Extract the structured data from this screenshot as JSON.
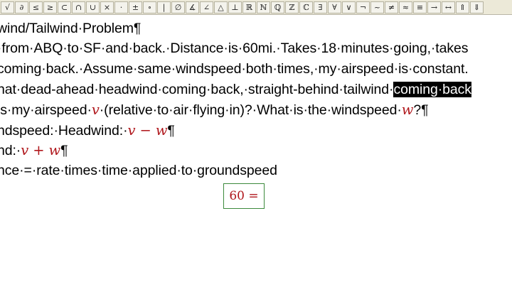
{
  "toolbar": {
    "buttons": [
      {
        "glyph": "√",
        "icon": "radical-icon"
      },
      {
        "glyph": "∂",
        "icon": "partial-icon"
      },
      {
        "glyph": "≤",
        "icon": "less-equal-icon"
      },
      {
        "glyph": "≥",
        "icon": "greater-equal-icon"
      },
      {
        "glyph": "⊂",
        "icon": "subset-icon"
      },
      {
        "glyph": "∩",
        "icon": "intersection-icon"
      },
      {
        "glyph": "∪",
        "icon": "union-icon"
      },
      {
        "glyph": "×",
        "icon": "times-icon"
      },
      {
        "glyph": "·",
        "icon": "dot-icon"
      },
      {
        "glyph": "±",
        "icon": "plus-minus-icon"
      },
      {
        "glyph": "∘",
        "icon": "composition-icon"
      },
      {
        "glyph": "|",
        "icon": "bar-icon"
      },
      {
        "glyph": "∅",
        "icon": "empty-set-icon"
      },
      {
        "glyph": "∡",
        "icon": "measured-angle-icon"
      },
      {
        "glyph": "∠",
        "icon": "angle-icon"
      },
      {
        "glyph": "△",
        "icon": "triangle-icon"
      },
      {
        "glyph": "⊥",
        "icon": "perpendicular-icon"
      },
      {
        "glyph": "ℝ",
        "icon": "reals-icon"
      },
      {
        "glyph": "ℕ",
        "icon": "naturals-icon"
      },
      {
        "glyph": "ℚ",
        "icon": "rationals-icon"
      },
      {
        "glyph": "ℤ",
        "icon": "integers-icon"
      },
      {
        "glyph": "ℂ",
        "icon": "complex-icon"
      },
      {
        "glyph": "∃",
        "icon": "exists-icon"
      },
      {
        "glyph": "∀",
        "icon": "for-all-icon"
      },
      {
        "glyph": "∨",
        "icon": "or-icon"
      },
      {
        "glyph": "¬",
        "icon": "not-icon"
      },
      {
        "glyph": "~",
        "icon": "tilde-icon"
      },
      {
        "glyph": "≠",
        "icon": "not-equal-icon"
      },
      {
        "glyph": "≈",
        "icon": "approx-icon"
      },
      {
        "glyph": "≡",
        "icon": "equivalent-icon"
      },
      {
        "glyph": "→",
        "icon": "right-arrow-icon"
      },
      {
        "glyph": "↔",
        "icon": "double-arrow-icon"
      },
      {
        "glyph": "⇑",
        "icon": "up-double-arrow-icon"
      },
      {
        "glyph": "⇓",
        "icon": "down-double-arrow-icon"
      }
    ]
  },
  "document": {
    "title": "wind/Tailwind·Problem",
    "line2": "·from·ABQ·to·SF·and·back.·Distance·is·60mi.·Takes·18·minutes·going,·takes",
    "line3": "coming·back.·Assume·same·windspeed·both·times,·my·airspeed·is·constant.",
    "line4_pre": "hat·dead-ahead·headwind·coming·back,·straight-behind·tailwind·",
    "line4_sel": "coming·back",
    "line5_a": "is·my·airspeed·",
    "line5_v": "v",
    "line5_b": "·(relative·to·air·flying·in)?·What·is·the·windspeed·",
    "line5_w": "w",
    "line5_c": "?",
    "line6_a": "ndspeed:·Headwind:·",
    "line6_math": "v − w",
    "line7_a": "nd:·",
    "line7_math": "v + w",
    "line8": "nce·=·rate·times·time·applied·to·groundspeed",
    "math_box": "60 =",
    "pilcrow": "¶"
  }
}
